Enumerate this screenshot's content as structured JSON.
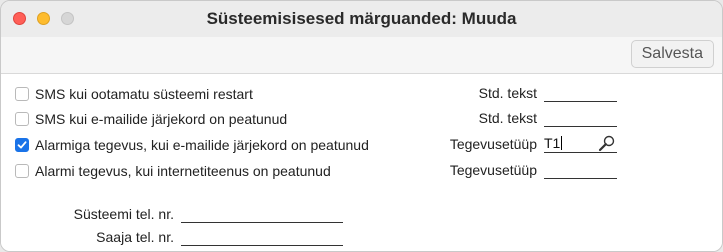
{
  "window": {
    "title": "Süsteemisisesed märguanded: Muuda"
  },
  "toolbar": {
    "save_label": "Salvesta"
  },
  "checkboxes": [
    {
      "label": "SMS kui ootamatu süsteemi restart",
      "checked": false
    },
    {
      "label": "SMS kui e-mailide järjekord on peatunud",
      "checked": false
    },
    {
      "label": "Alarmiga tegevus, kui e-mailide järjekord on peatunud",
      "checked": true
    },
    {
      "label": "Alarmi tegevus, kui internetiteenus on peatunud",
      "checked": false
    }
  ],
  "right_fields": [
    {
      "label": "Std. tekst",
      "value": ""
    },
    {
      "label": "Std. tekst",
      "value": ""
    },
    {
      "label": "Tegevusetüüp",
      "value": "T1"
    },
    {
      "label": "Tegevusetüüp",
      "value": ""
    }
  ],
  "bottom_fields": [
    {
      "label": "Süsteemi tel. nr.",
      "value": ""
    },
    {
      "label": "Saaja tel. nr.",
      "value": ""
    }
  ],
  "icons": {
    "search": "magnifier-icon",
    "check": "checkmark-icon"
  },
  "colors": {
    "accent": "#1a73e8",
    "close": "#ff5f57",
    "minimize": "#febc2e",
    "maximize_disabled": "#d6d6d6"
  }
}
